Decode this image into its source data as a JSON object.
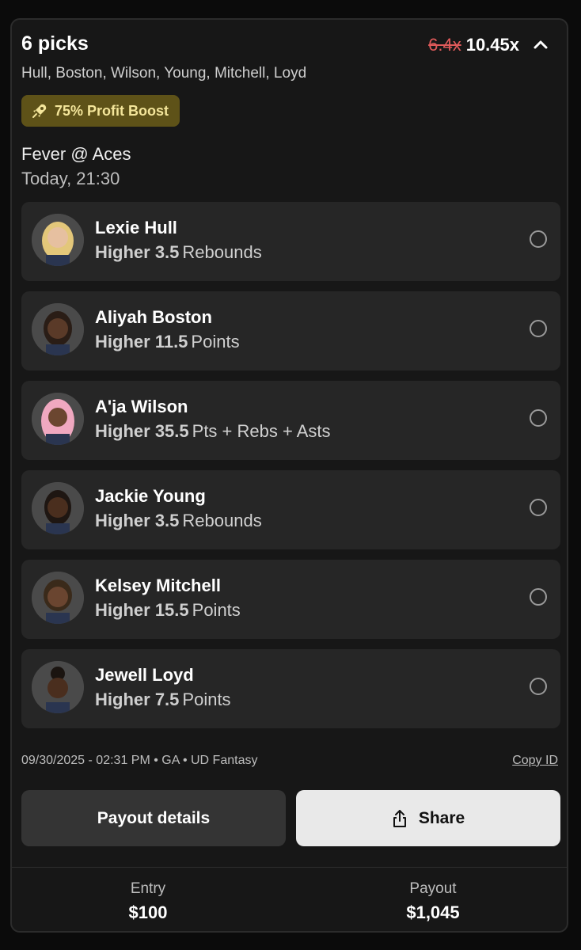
{
  "header": {
    "title": "6 picks",
    "old_multiplier": "6.4x",
    "new_multiplier": "10.45x",
    "player_names": "Hull, Boston, Wilson, Young, Mitchell, Loyd"
  },
  "boost": {
    "label": "75% Profit Boost",
    "icon": "rocket-icon"
  },
  "game": {
    "title": "Fever @ Aces",
    "time": "Today, 21:30"
  },
  "picks": [
    {
      "name": "Lexie Hull",
      "direction": "Higher",
      "line": "3.5",
      "stat": "Rebounds"
    },
    {
      "name": "Aliyah Boston",
      "direction": "Higher",
      "line": "11.5",
      "stat": "Points"
    },
    {
      "name": "A'ja Wilson",
      "direction": "Higher",
      "line": "35.5",
      "stat": "Pts + Rebs + Asts"
    },
    {
      "name": "Jackie Young",
      "direction": "Higher",
      "line": "3.5",
      "stat": "Rebounds"
    },
    {
      "name": "Kelsey Mitchell",
      "direction": "Higher",
      "line": "15.5",
      "stat": "Points"
    },
    {
      "name": "Jewell Loyd",
      "direction": "Higher",
      "line": "7.5",
      "stat": "Points"
    }
  ],
  "footer": {
    "meta": "09/30/2025 - 02:31 PM • GA • UD Fantasy",
    "copy_id": "Copy ID",
    "payout_details": "Payout details",
    "share": "Share"
  },
  "totals": {
    "entry_label": "Entry",
    "entry_value": "$100",
    "payout_label": "Payout",
    "payout_value": "$1,045"
  },
  "colors": {
    "background": "#171717",
    "row": "#262626",
    "boost_bg": "#5e5218",
    "boost_text": "#f3e59a",
    "strike": "#e05a5a"
  }
}
